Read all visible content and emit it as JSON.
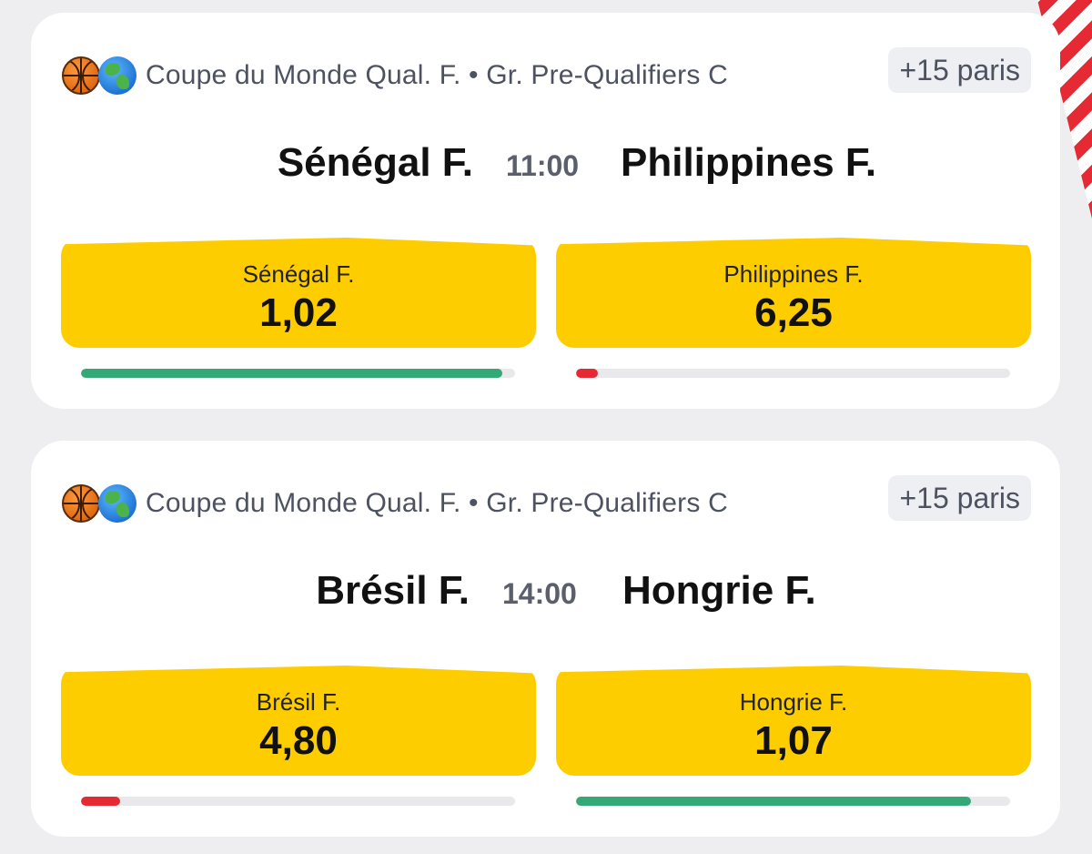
{
  "colors": {
    "accent_yellow": "#fdcd00",
    "favorite_green": "#34a877",
    "underdog_red": "#e52a33",
    "card_bg": "#ffffff",
    "page_bg": "#eeeef0"
  },
  "matches": [
    {
      "icons": [
        "basketball-icon",
        "globe-icon"
      ],
      "league": "Coupe du Monde Qual. F. • Gr. Pre-Qualifiers C",
      "more_bets": "+15 paris",
      "home": "Sénégal F.",
      "time": "11:00",
      "away": "Philippines F.",
      "odds": [
        {
          "label": "Sénégal F.",
          "value": "1,02",
          "probability": 0.97,
          "color": "#34a877"
        },
        {
          "label": "Philippines F.",
          "value": "6,25",
          "probability": 0.05,
          "color": "#e52a33"
        }
      ]
    },
    {
      "icons": [
        "basketball-icon",
        "globe-icon"
      ],
      "league": "Coupe du Monde Qual. F. • Gr. Pre-Qualifiers C",
      "more_bets": "+15 paris",
      "home": "Brésil F.",
      "time": "14:00",
      "away": "Hongrie F.",
      "odds": [
        {
          "label": "Brésil F.",
          "value": "4,80",
          "probability": 0.09,
          "color": "#e52a33"
        },
        {
          "label": "Hongrie F.",
          "value": "1,07",
          "probability": 0.91,
          "color": "#34a877"
        }
      ]
    }
  ]
}
